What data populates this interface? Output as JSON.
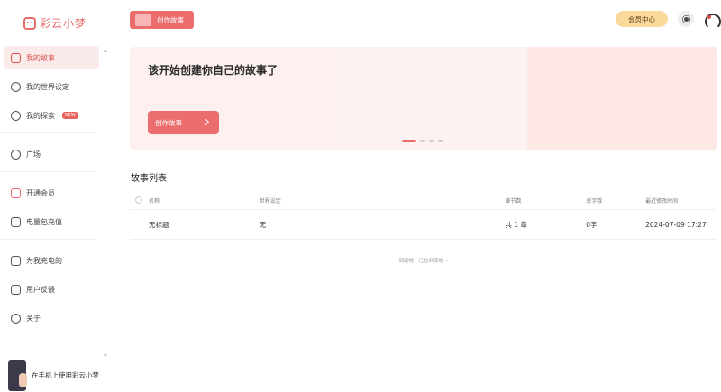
{
  "app": {
    "logo_text": "彩云小梦"
  },
  "topbar": {
    "create_label": "创作故事",
    "member_label": "会员中心"
  },
  "sidebar": {
    "items": [
      {
        "label": "我的故事",
        "icon": "book-icon",
        "active": true
      },
      {
        "label": "我的世界设定",
        "icon": "globe-icon"
      },
      {
        "label": "我的探索",
        "icon": "explore-icon",
        "badge": "NEW"
      },
      {
        "label": "广场",
        "icon": "compass-icon"
      },
      {
        "label": "开通会员",
        "icon": "crown-icon"
      },
      {
        "label": "电量包充值",
        "icon": "battery-icon"
      },
      {
        "label": "为我充电的",
        "icon": "charge-icon"
      },
      {
        "label": "用户反馈",
        "icon": "feedback-icon"
      },
      {
        "label": "关于",
        "icon": "info-icon"
      }
    ],
    "mobile_promo": "在手机上使用彩云小梦"
  },
  "banner": {
    "title": "该开始创建你自己的故事了",
    "button": "创作故事",
    "active_slide": 1,
    "slide_count": 4
  },
  "story_list": {
    "title": "故事列表",
    "columns": [
      "名称",
      "世界设定",
      "章节数",
      "总字数",
      "最近修改时间"
    ],
    "rows": [
      {
        "name": "无标题",
        "world": "无",
        "chapters": "共 1 章",
        "words": "0字",
        "modified": "2024-07-09 17:27"
      }
    ],
    "end_note": "到底啦，已拉到底啦～"
  },
  "colors": {
    "accent": "#ec6d6d",
    "member": "#fbd99b",
    "active_bg": "#fbeaea"
  }
}
